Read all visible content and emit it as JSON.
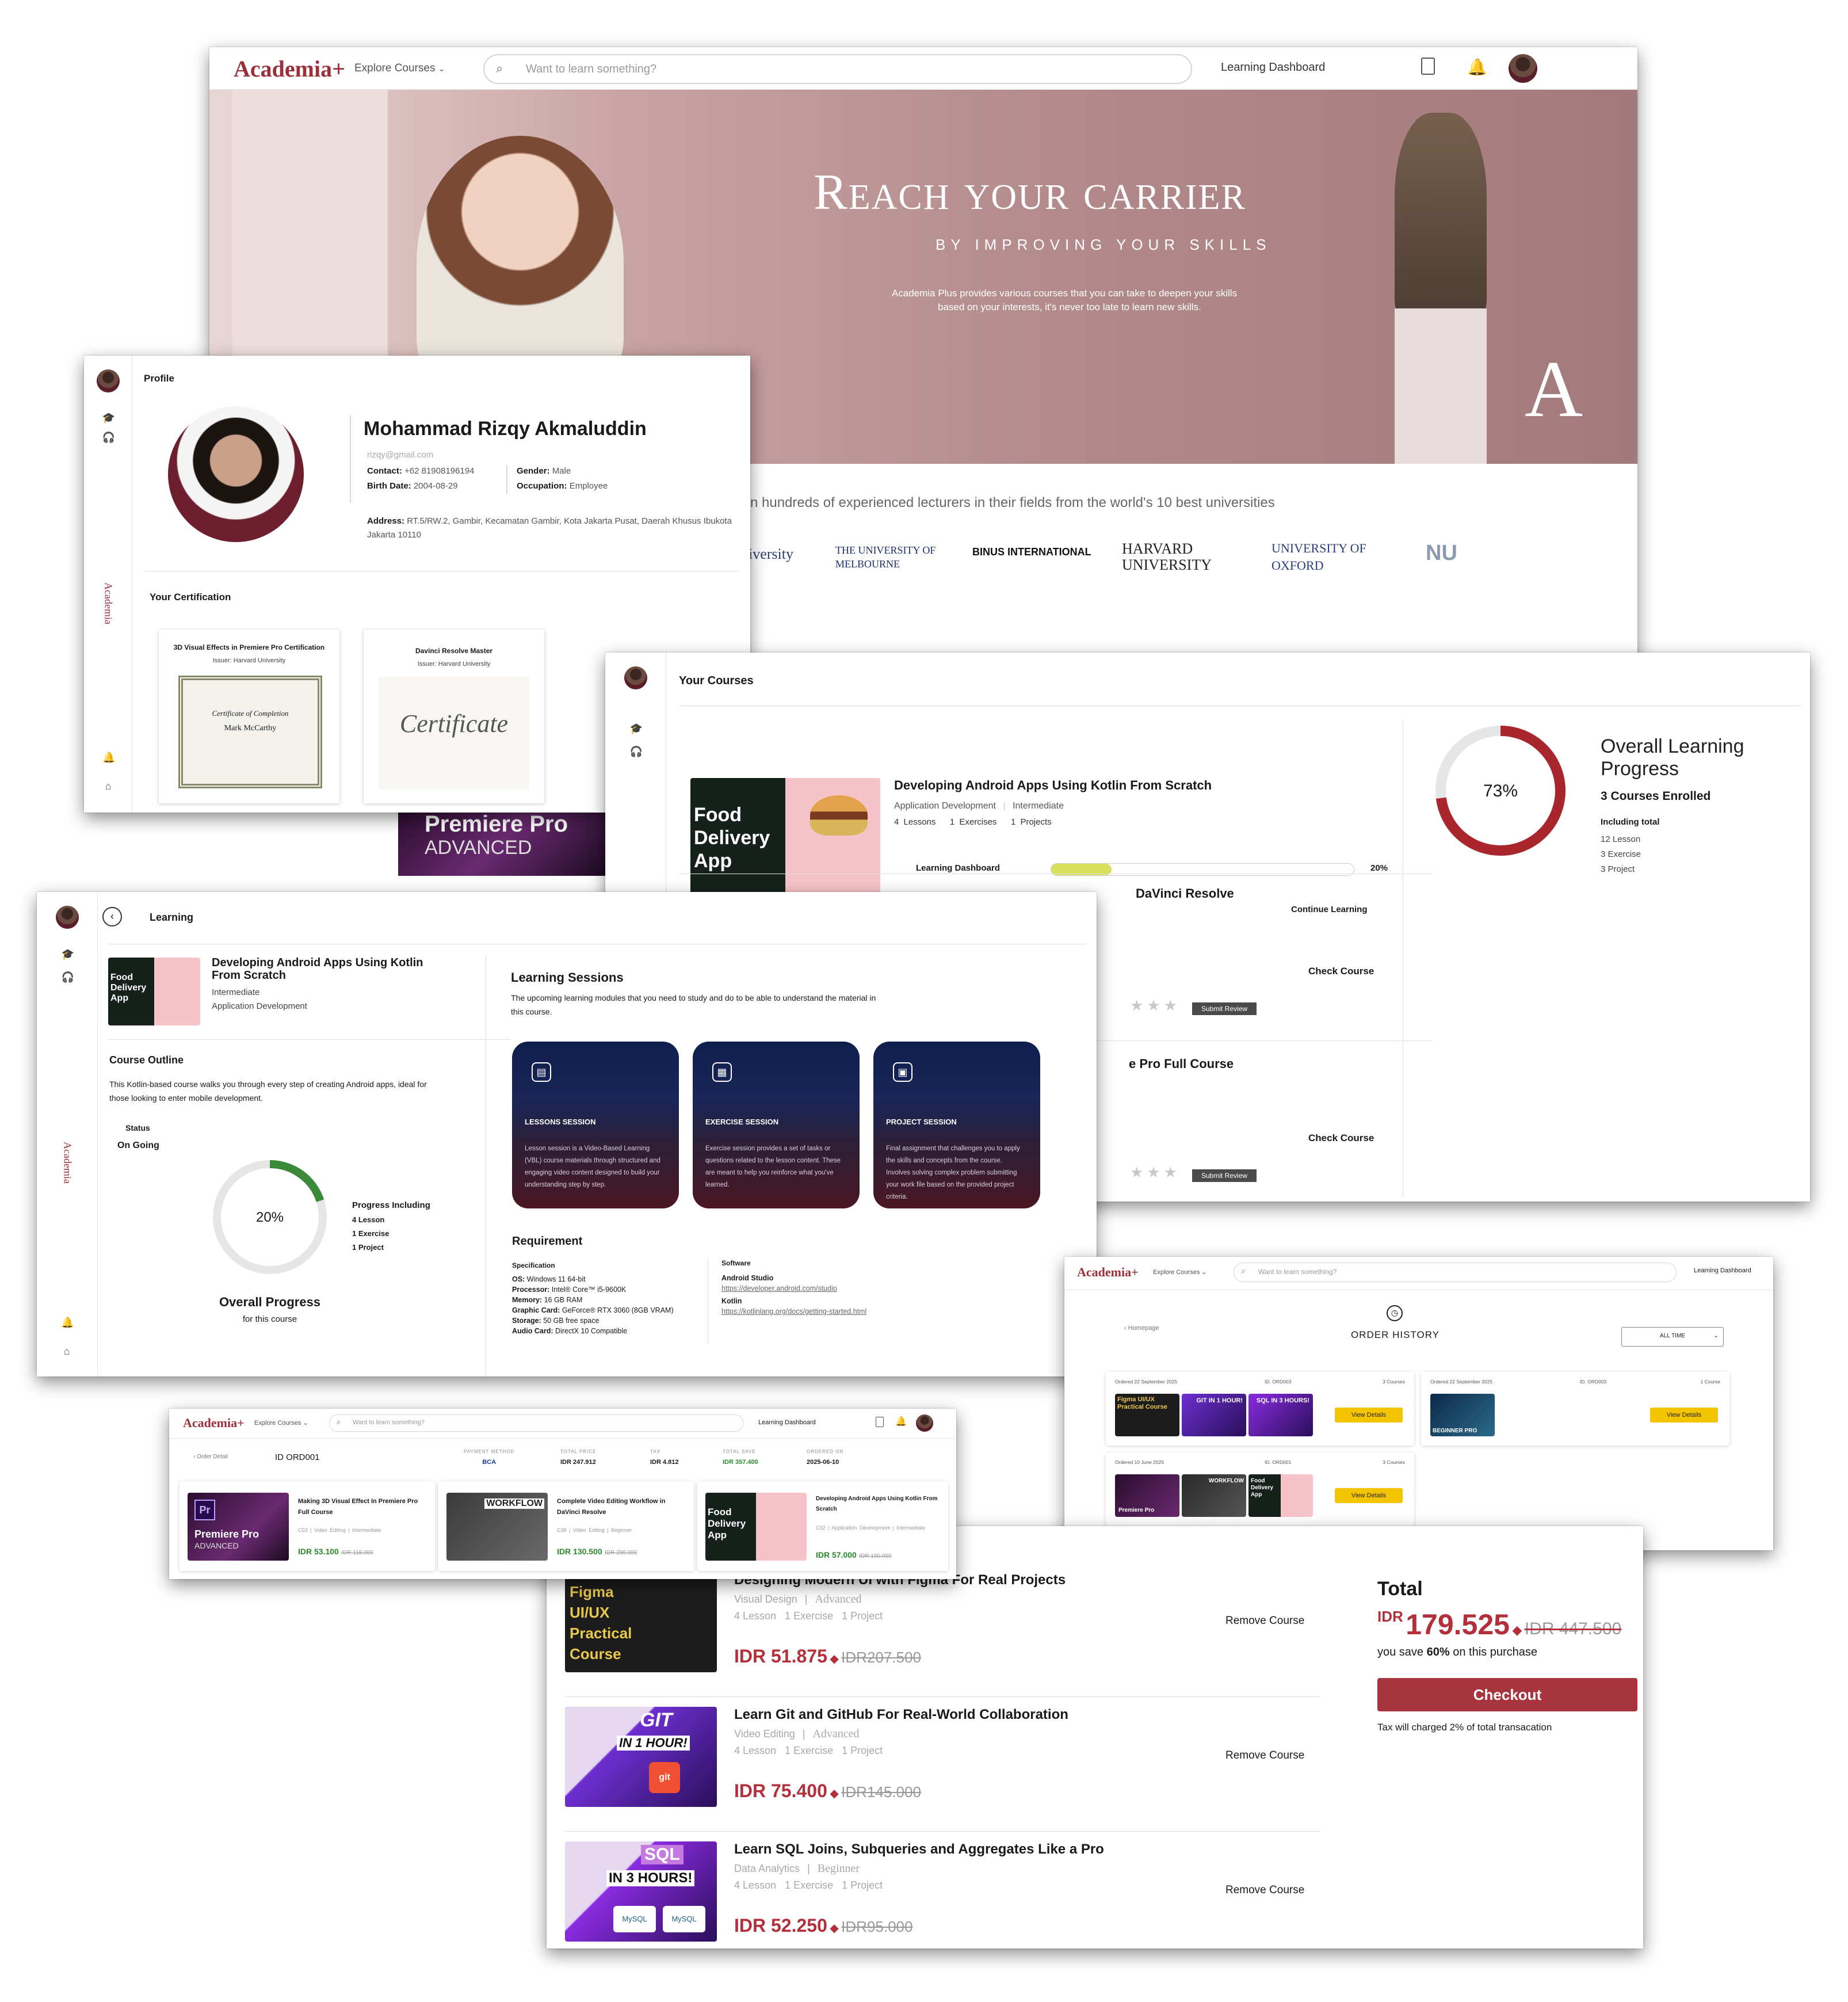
{
  "landing": {
    "logo": "Academia+",
    "explore": "Explore Courses",
    "search_placeholder": "Want to learn something?",
    "dashboard": "Learning Dashboard",
    "hero_title": "Reach your carrier",
    "hero_subtitle": "BY IMPROVING YOUR SKILLS",
    "hero_desc_1": "Academia Plus provides various courses that you can take to deepen your skills",
    "hero_desc_2": "based on your interests, it's never too late to learn new skills.",
    "hero_mark": "A",
    "lecturers_text": "n hundreds of experienced lecturers in their fields from the world's 10 best universities",
    "universities": [
      "niversity",
      "THE UNIVERSITY OF MELBOURNE",
      "BINUS INTERNATIONAL",
      "HARVARD UNIVERSITY",
      "UNIVERSITY OF OXFORD",
      "NU"
    ]
  },
  "profile": {
    "header": "Profile",
    "name": "Mohammad Rizqy Akmaluddin",
    "email": "rizqy@gmail.com",
    "contact_label": "Contact:",
    "contact_value": "+62 81908196194",
    "birth_label": "Birth Date:",
    "birth_value": "2004-08-29",
    "gender_label": "Gender:",
    "gender_value": "Male",
    "occupation_label": "Occupation:",
    "occupation_value": "Employee",
    "address_label": "Address:",
    "address_value": "RT.5/RW.2, Gambir, Kecamatan Gambir, Kota Jakarta Pusat, Daerah Khusus Ibukota Jakarta 10110",
    "cert_header": "Your Certification",
    "certs": [
      {
        "title": "3D Visual Effects in Premiere Pro Certification",
        "issuer": "Issuer: Harvard University",
        "image_text": "Certificate of Completion",
        "person": "Mark McCarthy"
      },
      {
        "title": "Davinci Resolve Master",
        "issuer": "Issuer: Harvard University",
        "image_text": "Certificate"
      }
    ],
    "side_logo": "Academia"
  },
  "behind_premiere": {
    "title": "Premiere Pro",
    "subtitle": "ADVANCED"
  },
  "courses": {
    "header": "Your Courses",
    "main_course": {
      "title": "Developing Android Apps Using Kotlin From Scratch",
      "category": "Application Development",
      "level": "Intermediate",
      "lessons": "4 Lessons",
      "exercises": "1 Exercises",
      "projects": "1 Projects",
      "progress_label": "Learning Dashboard",
      "progress_value": "20%",
      "progress_fraction": 0.2,
      "continue": "Continue Learning",
      "thumb_text": "Food Delivery App"
    },
    "row2_title": "DaVinci Resolve",
    "row3_title": "e Pro Full Course",
    "check_course": "Check Course",
    "submit_review": "Submit Review",
    "overall": {
      "title": "Overall Learning Progress",
      "percent": "73%",
      "fraction": 0.73,
      "enrolled": "3 Courses Enrolled",
      "including": "Including total",
      "lessons": "12 Lesson",
      "exercises": "3 Exercise",
      "projects": "3 Project"
    }
  },
  "learning": {
    "header": "Learning",
    "course_title": "Developing Android Apps Using Kotlin From Scratch",
    "level": "Intermediate",
    "category": "Application Development",
    "outline_title": "Course Outline",
    "outline_text": "This Kotlin-based course walks you through every step of creating Android apps, ideal for those looking to enter mobile development.",
    "status_label": "Status",
    "status_value": "On Going",
    "progress": "20%",
    "progress_fraction": 0.2,
    "progress_including": "Progress Including",
    "pi_lesson": "4 Lesson",
    "pi_exercise": "1 Exercise",
    "pi_project": "1 Project",
    "overall_title": "Overall Progress",
    "overall_sub": "for this course",
    "sessions_title": "Learning Sessions",
    "sessions_desc": "The upcoming learning modules that you need to study and do to be able to understand the material in this course.",
    "sessions": [
      {
        "title": "LESSONS SESSION",
        "desc": "Lesson session is a Video-Based Learning (VBL) course materials through structured and engaging video content designed to build your understanding step by step."
      },
      {
        "title": "EXERCISE SESSION",
        "desc": "Exercise session provides a set of tasks or questions related to the lesson content. These are meant to help you reinforce what you've learned."
      },
      {
        "title": "PROJECT SESSION",
        "desc": "Final assignment that challenges you to apply the skills and concepts from the course. Involves solving complex problem submitting your work file based on the provided project criteria."
      }
    ],
    "requirement_title": "Requirement",
    "spec_label": "Specification",
    "specs": [
      {
        "k": "OS:",
        "v": "Windows 11 64-bit"
      },
      {
        "k": "Processor:",
        "v": "Intel® Core™ i5-9600K"
      },
      {
        "k": "Memory:",
        "v": "16 GB RAM"
      },
      {
        "k": "Graphic Card:",
        "v": "GeForce® RTX 3060 (8GB VRAM)"
      },
      {
        "k": "Storage:",
        "v": "50 GB free space"
      },
      {
        "k": "Audio Card:",
        "v": "DirectX 10 Compatible"
      }
    ],
    "software_label": "Software",
    "sw1_name": "Android Studio",
    "sw1_link": "https://developer.android.com/studio",
    "sw2_name": "Kotlin",
    "sw2_link": "https://kotlinlang.org/docs/getting-started.html",
    "side_logo": "Academia"
  },
  "order_history": {
    "logo": "Academia+",
    "explore": "Explore Courses",
    "search_placeholder": "Want to learn something?",
    "dashboard": "Learning Dashboard",
    "back": "Homepage",
    "title": "ORDER HISTORY",
    "filter": "ALL TIME",
    "orders": [
      {
        "date": "Ordered 22 September 2025",
        "id": "ID. ORD003",
        "count": "3 Courses",
        "button": "View Details",
        "thumb1": "Figma UI/UX Practical Course",
        "thumb2": "GIT IN 1 HOUR!",
        "thumb3": "SQL IN 3 HOURS!"
      },
      {
        "date": "Ordered 22 September 2025",
        "id": "ID. ORD003",
        "count": "1 Course",
        "button": "View Details",
        "thumb1": "BEGINNER PRO"
      },
      {
        "date": "Ordered 10 June 2025",
        "id": "ID. ORD001",
        "count": "3 Courses",
        "button": "View Details",
        "thumb1": "Premiere Pro",
        "thumb2": "WORKFLOW",
        "thumb3": "Food Delivery App"
      }
    ]
  },
  "order_detail": {
    "logo": "Academia+",
    "explore": "Explore Courses",
    "search_placeholder": "Want to learn something?",
    "dashboard": "Learning Dashboard",
    "back": "Order Detail",
    "id": "ID ORD001",
    "payment_label": "PAYMENT METHOD",
    "payment_value": "BCA",
    "total_label": "TOTAL PRICE",
    "total_value": "IDR 247.912",
    "tax_label": "TAX",
    "tax_value": "IDR 4.812",
    "save_label": "TOTAL SAVE",
    "save_value": "IDR 357.400",
    "ordered_label": "ORDERED ON",
    "ordered_value": "2025-06-10",
    "items": [
      {
        "title": "Making 3D Visual Effect In Premiere Pro Full Course",
        "t1": "C03",
        "t2": "Video Editing",
        "t3": "Intermediate",
        "price": "IDR 53.100",
        "old": "IDR 118.000",
        "thumb": "Premiere Pro",
        "thumb_sub": "ADVANCED"
      },
      {
        "title": "Complete Video Editing Workflow in DaVinci Resolve",
        "t1": "C38",
        "t2": "Video Editing",
        "t3": "Beginner",
        "price": "IDR 130.500",
        "old": "IDR 290.000",
        "thumb": "WORKFLOW"
      },
      {
        "title": "Developing Android Apps Using Kotlin From Scratch",
        "t1": "C02",
        "t2": "Application Development",
        "t3": "Intermediate",
        "price": "IDR 57.000",
        "old": "IDR 190.000",
        "thumb": "Food Delivery App"
      }
    ]
  },
  "cart": {
    "items": [
      {
        "title": "Designing Modern UI with Figma For Real Projects",
        "category": "Visual Design",
        "level": "Advanced",
        "meta": "4 Lesson   1 Exercise   1 Project",
        "price": "IDR 51.875",
        "old": "IDR207.500",
        "remove": "Remove Course",
        "thumb": "Figma UI/UX Practical Course"
      },
      {
        "title": "Learn Git and GitHub For Real-World Collaboration",
        "category": "Video Editing",
        "level": "Advanced",
        "meta": "4 Lesson   1 Exercise   1 Project",
        "price": "IDR 75.400",
        "old": "IDR145.000",
        "remove": "Remove Course",
        "thumb": "GIT",
        "thumb_sub": "IN 1 HOUR!"
      },
      {
        "title": "Learn SQL Joins, Subqueries and Aggregates Like a Pro",
        "category": "Data Analytics",
        "level": "Beginner",
        "meta": "4 Lesson   1 Exercise   1 Project",
        "price": "IDR 52.250",
        "old": "IDR95.000",
        "remove": "Remove Course",
        "thumb": "SQL",
        "thumb_sub": "IN 3 HOURS!"
      }
    ],
    "total_label": "Total",
    "total_currency": "IDR",
    "total_value": "179.525",
    "total_old": "IDR 447.500",
    "save_prefix": "you save",
    "save_pct": "60%",
    "save_suffix": "on this purchase",
    "checkout": "Checkout",
    "tax_note": "Tax will charged 2% of total transacation"
  },
  "colors": {
    "brand": "#9b2f3a",
    "progress_ring": "#a8262c",
    "progress_bar": "#d6e05a",
    "learning_ring": "#3a8a3a",
    "yellow": "#f5c400"
  }
}
